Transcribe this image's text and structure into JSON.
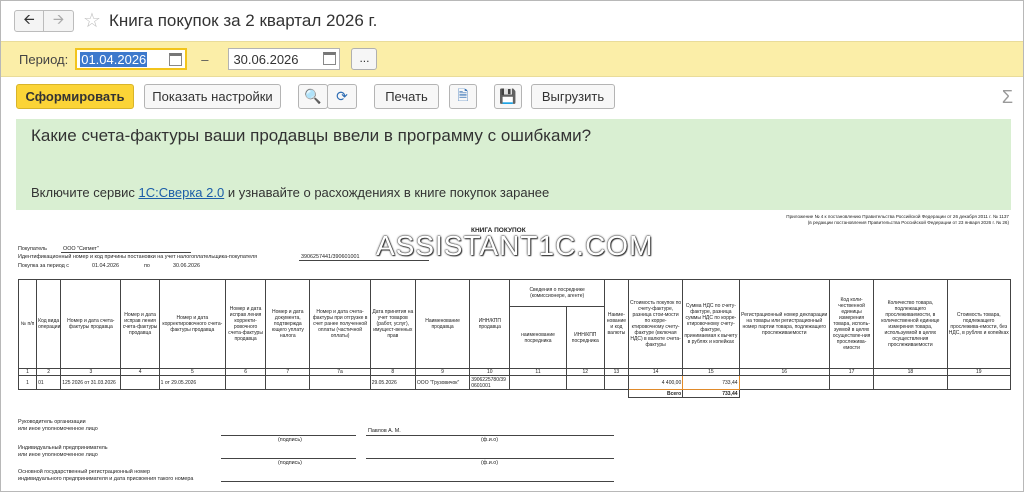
{
  "window": {
    "title": "Книга покупок за 2 квартал 2026 г."
  },
  "period": {
    "label": "Период:",
    "from": "01.04.2026",
    "dash": "–",
    "to": "30.06.2026",
    "more": "..."
  },
  "toolbar": {
    "generate": "Сформировать",
    "show_settings": "Показать настройки",
    "print": "Печать",
    "export": "Выгрузить"
  },
  "banner": {
    "question": "Какие счета-фактуры ваши продавцы ввели в программу с ошибками?",
    "text_before": "Включите сервис ",
    "link": "1С:Сверка 2.0",
    "text_after": " и узнавайте о расхождениях в книге покупок заранее"
  },
  "report": {
    "appendix_1": "Приложение № 4 к постановлению Правительства Российской Федерации от 26 декабря 2011 г. № 1137",
    "appendix_2": "(в редакции постановления Правительства Российской Федерации от 23 января 2026 г. № 26)",
    "title": "КНИГА ПОКУПОК",
    "watermark": "ASSISTANT1C.COM",
    "buyer_label": "Покупатель",
    "buyer": "ООО \"Сигмет\"",
    "inn_label": "Идентификационный номер и код причины постановки на учет налогоплательщика-покупателя",
    "inn": "3906257441/390601001",
    "period_label": "Покупка за период с",
    "period_from": "01.04.2026",
    "period_to_label": "по",
    "period_to": "30.06.2026",
    "intermediary_header": "Сведения о посреднике (комиссионере, агенте)",
    "headers": [
      "№ п/п",
      "Код вида операции",
      "Номер и дата счета-фактуры продавца",
      "Номер и дата исправ ления счета-фактуры продавца",
      "Номер и дата корректировочного счета-фактуры продавца",
      "Номер и дата исправ ления корректи-ровочного счета-фактуры продавца",
      "Номер и дата документа, подтвержда ющего уплату налога",
      "Номер и дата счета-фактуры при отгрузке в счет ранее полученной оплаты (частичной оплаты)",
      "Дата принятия на учет товаров (работ, услуг), имущест-венных прав",
      "Наименование продавца",
      "ИНН/КПП продавца",
      "наименование посредника",
      "ИНН/КПП посредника",
      "Наиме-нование и код валюты",
      "Стоимость покупок по счету-фактуре, разница стои-мости по корре-ктировочному счету-фактуре (включая НДС) в валюте счета-фактуры",
      "Сумма НДС по счету-фактуре, разница суммы НДС по корре-ктировочному счету-фактуре, принимаемая к вычету в рублях и копейках",
      "Регистрационный номер декларации на товары или регистрационный номер партии товара, подлежащего прослеживаемости",
      "Код коли-чественной единицы измерения товара, исполь-зуемой в целях осуществле-ния прослежива-емости",
      "Количество товара, подлежащего прослеживаемости, в количественной единице измерения товара, используемой в целях осуществления прослеживаемости",
      "Стоимость товара, подлежащего прослежива-емости, без НДС, в рублях и копейках"
    ],
    "col_numbers": [
      "1",
      "2",
      "3",
      "4",
      "5",
      "6",
      "7",
      "7а",
      "8",
      "9",
      "10",
      "11",
      "12",
      "13",
      "14",
      "15",
      "16",
      "17",
      "18",
      "19"
    ],
    "row": {
      "n": "1",
      "code": "01",
      "invoice": "125 2026 от 31.03.2026",
      "payment": "1 от 29.05.2026",
      "accept_date": "29.05.2026",
      "seller": "ООО \"Грузовичок\"",
      "seller_inn": "3906225780/390601001",
      "cost": "4 400,00",
      "vat": "733,44"
    },
    "total_label": "Всего",
    "total_vat": "733,44",
    "sign_head": "Руководитель организации",
    "sign_head2": "или иное уполномоченное лицо",
    "sign_name": "Павлов А. М.",
    "sign_caption": "(подпись)",
    "fio_caption": "(ф.и.о)",
    "ip_label": "Индивидуальный предприниматель",
    "ip_label2": "или иное уполномоченное лицо",
    "reg_label": "Основной государственный регистрационный номер",
    "reg_label2": "индивидуального предпринимателя и дата присвоения такого номера"
  }
}
